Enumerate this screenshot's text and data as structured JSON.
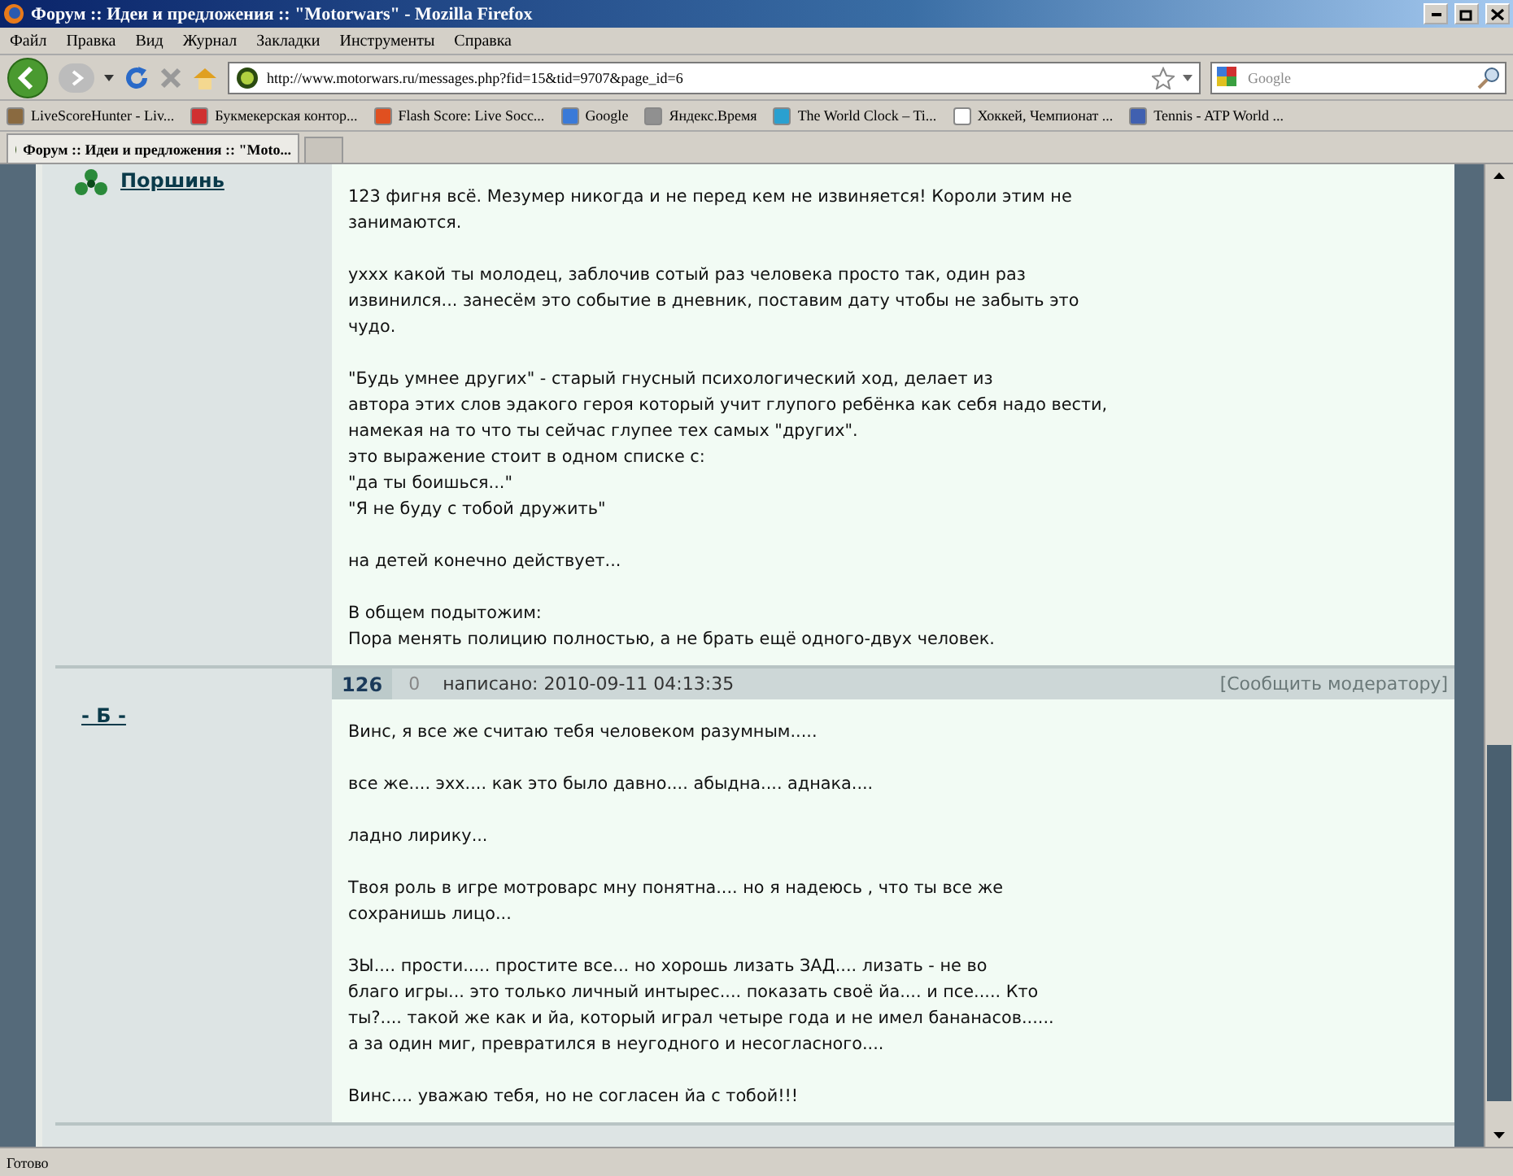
{
  "window": {
    "title": "Форум :: Идеи и предложения :: \"Motorwars\" - Mozilla Firefox"
  },
  "menu": [
    "Файл",
    "Правка",
    "Вид",
    "Журнал",
    "Закладки",
    "Инструменты",
    "Справка"
  ],
  "address": {
    "value": "http://www.motorwars.ru/messages.php?fid=15&tid=9707&page_id=6"
  },
  "search": {
    "placeholder": "Google"
  },
  "bookmarks": [
    {
      "label": "LiveScoreHunter - Liv...",
      "color": "#8a6a40"
    },
    {
      "label": "Букмекерская контор...",
      "color": "#d03030"
    },
    {
      "label": "Flash Score: Live Socc...",
      "color": "#e05020"
    },
    {
      "label": "Google",
      "color": "#3a7ad8"
    },
    {
      "label": "Яндекс.Время",
      "color": "#909090"
    },
    {
      "label": "The World Clock – Ti...",
      "color": "#2aa0d0"
    },
    {
      "label": "Хоккей, Чемпионат ...",
      "color": "#ffffff"
    },
    {
      "label": "Tennis - ATP World ...",
      "color": "#4060b0"
    }
  ],
  "tabs": [
    {
      "label": "Форум :: Идеи и предложения :: \"Moto...",
      "selected": true
    }
  ],
  "posts": [
    {
      "author": "Поршинь",
      "has_icon": true,
      "paragraphs": [
        [
          "123 фигня всё. Мезумер никогда и не перед кем не извиняется! Короли этим не",
          "занимаются."
        ],
        [
          "уххх какой ты молодец, заблочив сотый раз человека просто так, один раз",
          "извинился... занесём это событие в дневник, поставим дату чтобы не забыть это",
          "чудо."
        ],
        [
          "\"Будь умнее других\" - старый гнусный психологический ход, делает из",
          "автора этих слов эдакого героя который учит глупого ребёнка как себя надо вести,",
          "намекая на то что ты сейчас глупее тех самых \"других\".",
          "это выражение стоит в одном списке с:",
          "\"да ты боишься...\"",
          "\"Я не буду с тобой дружить\""
        ],
        [
          "на детей конечно действует..."
        ],
        [
          "В общем подытожим:",
          "Пора менять полицию полностью, а не брать ещё одного-двух человек."
        ]
      ]
    },
    {
      "author": "- Б -",
      "has_icon": false,
      "number": "126",
      "rating": "0",
      "date": "написано: 2010-09-11 04:13:35",
      "report": "[Сообщить модератору]",
      "paragraphs": [
        [
          "Винс, я все же считаю тебя человеком разумным....."
        ],
        [
          "все же.... эхх.... как это было давно.... абыдна.... аднака...."
        ],
        [
          "ладно лирику..."
        ],
        [
          "Твоя роль в игре мотроварс мну понятна.... но я надеюсь , что ты все же",
          "сохранишь лицо..."
        ],
        [
          "ЗЫ.... прости..... простите все... но хорошь лизать ЗАД.... лизать - не во",
          "благо игры... это только личный интырес.... показать своё йа.... и псе..... Кто",
          "ты?.... такой же как и йа, который играл четыре года и не имел бананасов......",
          "а за один миг, превратился в неугодного и несогласного...."
        ],
        [
          "Винс.... уважаю тебя, но не согласен йа с тобой!!!"
        ]
      ]
    }
  ],
  "status_bar": "Готово"
}
